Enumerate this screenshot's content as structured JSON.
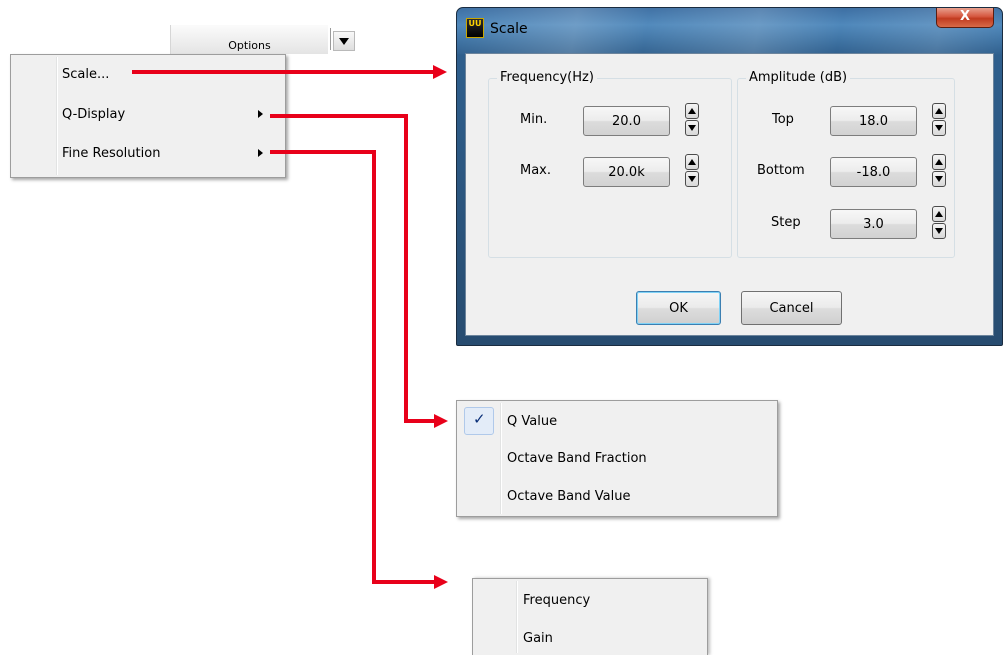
{
  "options_bar": {
    "label": "Options"
  },
  "main_menu": {
    "items": [
      {
        "label": "Scale..."
      },
      {
        "label": "Q-Display"
      },
      {
        "label": "Fine Resolution"
      }
    ]
  },
  "dialog": {
    "title": "Scale",
    "icon_text": "UU",
    "close_symbol": "X",
    "frequency_group": {
      "title": "Frequency(Hz)",
      "min_label": "Min.",
      "min_value": "20.0",
      "max_label": "Max.",
      "max_value": "20.0k"
    },
    "amplitude_group": {
      "title": "Amplitude (dB)",
      "top_label": "Top",
      "top_value": "18.0",
      "bottom_label": "Bottom",
      "bottom_value": "-18.0",
      "step_label": "Step",
      "step_value": "3.0"
    },
    "ok_label": "OK",
    "cancel_label": "Cancel"
  },
  "q_display_menu": {
    "check_symbol": "✓",
    "items": [
      {
        "label": "Q Value",
        "checked": true
      },
      {
        "label": "Octave Band Fraction",
        "checked": false
      },
      {
        "label": "Octave Band Value",
        "checked": false
      }
    ]
  },
  "fine_resolution_menu": {
    "items": [
      {
        "label": "Frequency"
      },
      {
        "label": "Gain"
      }
    ]
  },
  "colors": {
    "connector": "#e8001a",
    "title_bar": "#2f5f8d",
    "close_button": "#c03b20"
  }
}
